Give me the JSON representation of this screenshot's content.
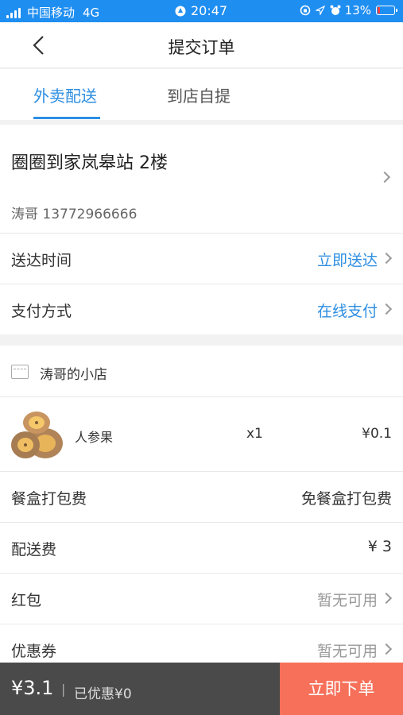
{
  "status_bar": {
    "carrier": "中国移动",
    "network": "4G",
    "time": "20:47",
    "battery": "13%",
    "battery_level": 0.13
  },
  "header": {
    "title": "提交订单",
    "back_icon": "chevron-left-icon"
  },
  "tabs": [
    {
      "label": "外卖配送",
      "active": true
    },
    {
      "label": "到店自提",
      "active": false
    }
  ],
  "address": {
    "title": "圈圈到家岚皋站 2楼",
    "contact": "涛哥 13772966666"
  },
  "delivery_time": {
    "label": "送达时间",
    "value": "立即送达"
  },
  "payment": {
    "label": "支付方式",
    "value": "在线支付"
  },
  "shop": {
    "name": "涛哥的小店",
    "icon": "store-icon"
  },
  "item": {
    "name": "人参果",
    "qty": "x1",
    "price": "¥0.1"
  },
  "packing_fee": {
    "label": "餐盒打包费",
    "value": "免餐盒打包费"
  },
  "delivery_fee": {
    "label": "配送费",
    "value": "¥ 3"
  },
  "red_packet": {
    "label": "红包",
    "value": "暂无可用"
  },
  "coupon": {
    "label": "优惠券",
    "value": "暂无可用"
  },
  "footer": {
    "total": "¥3.1",
    "separator": "|",
    "discount": "已优惠¥0",
    "submit": "立即下单"
  },
  "colors": {
    "status_bar": "#1f8ef1",
    "accent": "#2d8ee2",
    "submit_bg": "#f6705a",
    "footer_bg": "#4a4a4a"
  }
}
